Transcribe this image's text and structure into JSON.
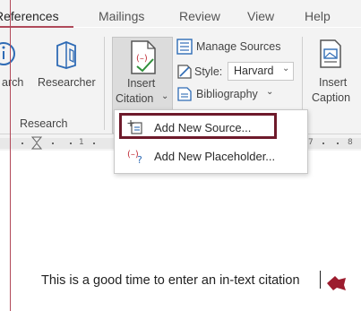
{
  "tabs": [
    {
      "label": "References",
      "active": true
    },
    {
      "label": "Mailings",
      "active": false
    },
    {
      "label": "Review",
      "active": false
    },
    {
      "label": "View",
      "active": false
    },
    {
      "label": "Help",
      "active": false
    }
  ],
  "ribbon": {
    "search_label": "arch",
    "researcher_label": "Researcher",
    "insert_citation_line1": "Insert",
    "insert_citation_line2": "Citation",
    "insert_citation_caret": "⌄",
    "manage_sources": "Manage Sources",
    "style_label": "Style:",
    "style_value": "Harvard",
    "style_caret": "⌄",
    "bibliography": "Bibliography",
    "bibliography_caret": "⌄",
    "insert_caption_line1": "Insert",
    "insert_caption_line2": "Caption",
    "research_group": "Research"
  },
  "ruler": {
    "marks": [
      "1",
      "7",
      "8"
    ]
  },
  "menu": {
    "items": [
      {
        "label": "Add New Source...",
        "icon": "add-source-icon"
      },
      {
        "label": "Add New Placeholder...",
        "icon": "add-placeholder-icon"
      }
    ]
  },
  "document": {
    "text": "This is a good time to enter an in-text citation"
  },
  "colors": {
    "accent": "#6e1a2b",
    "cursor": "#9c1c2e"
  }
}
